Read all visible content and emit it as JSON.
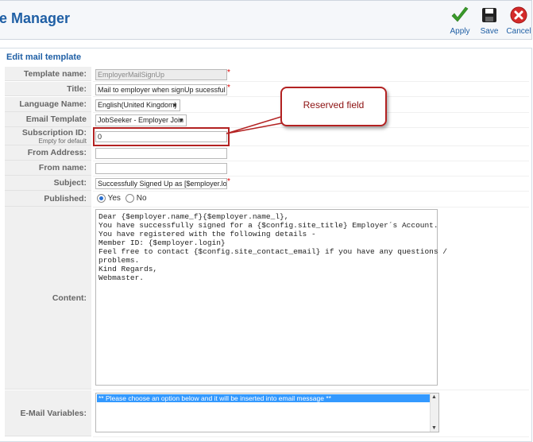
{
  "header": {
    "title": "e Manager",
    "toolbar": {
      "apply": "Apply",
      "save": "Save",
      "cancel": "Cancel"
    }
  },
  "panel": {
    "legend": "Edit mail template"
  },
  "form": {
    "template_name": {
      "label": "Template name:",
      "value": "EmployerMailSignUp"
    },
    "title": {
      "label": "Title:",
      "value": "Mail to employer when signUp sucessful"
    },
    "language": {
      "label": "Language Name:",
      "value": "English(United Kingdom)"
    },
    "group": {
      "label": "Email Template Group:",
      "value": "JobSeeker - Employer Join"
    },
    "subscription": {
      "label": "Subscription ID:",
      "sublabel": "Empty for default",
      "value": "0"
    },
    "from_address": {
      "label": "From Address:",
      "value": ""
    },
    "from_name": {
      "label": "From name:",
      "value": ""
    },
    "subject": {
      "label": "Subject:",
      "value": "Successfully Signed Up as [$employer.login]"
    },
    "published": {
      "label": "Published:",
      "yes": "Yes",
      "no": "No"
    },
    "content": {
      "label": "Content:",
      "lines": [
        "Dear {$employer.name_f}{$employer.name_l},",
        "",
        "You have successfully signed for a {$config.site_title} Employer´s Account.",
        "You have registered with the following details -",
        "",
        "Member ID: {$employer.login}",
        "",
        "Feel free to contact {$config.site_contact_email} if you have any questions /",
        "problems.",
        "",
        "Kind Regards,",
        "",
        "Webmaster."
      ]
    },
    "variables": {
      "label": "E-Mail Variables:",
      "selected": "** Please choose an option below and it will be inserted into email message **"
    }
  },
  "callout": {
    "text": "Reserved field"
  },
  "required_mark": "*"
}
